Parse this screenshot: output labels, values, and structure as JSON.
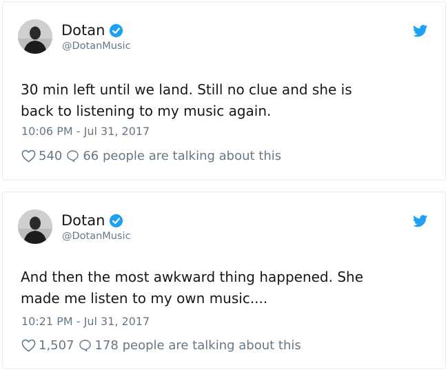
{
  "tweets": [
    {
      "display_name": "Dotan",
      "handle": "@DotanMusic",
      "text": "30 min left until we land. Still no clue and she is\nback to listening to my music again.",
      "timestamp": "10:06 PM - Jul 31, 2017",
      "likes": "540",
      "talking": "66 people are talking about this"
    },
    {
      "display_name": "Dotan",
      "handle": "@DotanMusic",
      "text": "And then the most awkward thing happened. She\nmade me listen to my own music....",
      "timestamp": "10:21 PM - Jul 31, 2017",
      "likes": "1,507",
      "talking": "178 people are talking about this"
    }
  ],
  "icons": {
    "verified": "verified-badge-icon",
    "brand": "twitter-bird-icon",
    "like": "heart-icon",
    "reply": "speech-bubble-icon"
  },
  "colors": {
    "verified_blue": "#1da1f2",
    "meta_gray": "#657786",
    "text_dark": "#14171a",
    "card_border": "#e6ecf0"
  }
}
